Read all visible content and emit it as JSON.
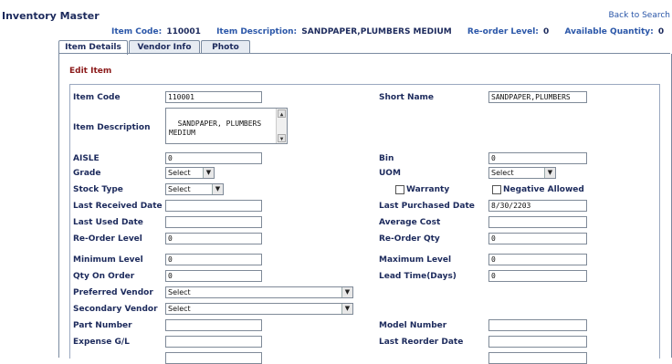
{
  "page": {
    "title": "Inventory Master",
    "back_link": "Back to Search"
  },
  "summary": {
    "item_code_label": "Item Code:",
    "item_code_value": "110001",
    "item_desc_label": "Item Description:",
    "item_desc_value": "SANDPAPER,PLUMBERS MEDIUM",
    "reorder_label": "Re-order Level:",
    "reorder_value": "0",
    "available_label": "Available Quantity:",
    "available_value": "0"
  },
  "tabs": [
    {
      "label": "Item Details",
      "active": true
    },
    {
      "label": "Vendor Info",
      "active": false
    },
    {
      "label": "Photo",
      "active": false
    }
  ],
  "form": {
    "title": "Edit Item",
    "item_code": {
      "label": "Item Code",
      "value": "110001"
    },
    "short_name": {
      "label": "Short Name",
      "value": "SANDPAPER,PLUMBERS"
    },
    "item_description": {
      "label": "Item Description",
      "value": "SANDPAPER, PLUMBERS\nMEDIUM"
    },
    "aisle": {
      "label": "AISLE",
      "value": "0"
    },
    "bin": {
      "label": "Bin",
      "value": "0"
    },
    "grade": {
      "label": "Grade",
      "value": "Select"
    },
    "uom": {
      "label": "UOM",
      "value": "Select"
    },
    "stock_type": {
      "label": "Stock Type",
      "value": "Select"
    },
    "warranty": {
      "label": "Warranty",
      "checked": false
    },
    "negative_allowed": {
      "label": "Negative Allowed",
      "checked": false
    },
    "last_received_date": {
      "label": "Last Received Date",
      "value": ""
    },
    "last_purchased_date": {
      "label": "Last Purchased Date",
      "value": "8/30/2203"
    },
    "last_used_date": {
      "label": "Last Used Date",
      "value": ""
    },
    "average_cost": {
      "label": "Average Cost",
      "value": ""
    },
    "reorder_level": {
      "label": "Re-Order Level",
      "value": "0"
    },
    "reorder_qty": {
      "label": "Re-Order Qty",
      "value": "0"
    },
    "minimum_level": {
      "label": "Minimum Level",
      "value": "0"
    },
    "maximum_level": {
      "label": "Maximum Level",
      "value": "0"
    },
    "qty_on_order": {
      "label": "Qty On Order",
      "value": "0"
    },
    "lead_time": {
      "label": "Lead Time(Days)",
      "value": "0"
    },
    "preferred_vendor": {
      "label": "Preferred Vendor",
      "value": "Select"
    },
    "secondary_vendor": {
      "label": "Secondary Vendor",
      "value": "Select"
    },
    "part_number": {
      "label": "Part Number",
      "value": ""
    },
    "model_number": {
      "label": "Model Number",
      "value": ""
    },
    "expense_gl": {
      "label": "Expense G/L",
      "value": ""
    },
    "last_reorder_date": {
      "label": "Last Reorder Date",
      "value": ""
    }
  },
  "colors": {
    "label": "#1c2a5c",
    "link": "#2a56a8",
    "edit_title": "#8b1a1a",
    "border": "#7a8aa0"
  }
}
